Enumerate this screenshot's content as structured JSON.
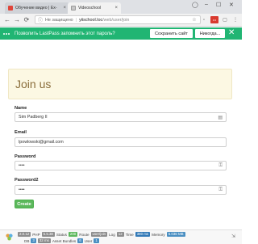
{
  "browser": {
    "tabs": [
      {
        "title": "Обучение видео | Ex-"
      },
      {
        "title": "Videoschool"
      }
    ],
    "window_controls": {
      "minimize": "–",
      "maximize": "☐",
      "close": "✕"
    },
    "url": {
      "security": "Не защищено",
      "host": "yiischool.loc",
      "path": "/web/user/join"
    }
  },
  "lastpass": {
    "message": "Позволить LastPass запомнить этот пароль?",
    "save_label": "Сохранить сайт",
    "never_label": "Никогда..."
  },
  "page": {
    "title": "Join us",
    "fields": [
      {
        "label": "Name",
        "value": "Sim Padberg II"
      },
      {
        "label": "Email",
        "value": "lpowlowski@gmail.com"
      },
      {
        "label": "Password",
        "value": "••••"
      },
      {
        "label": "Password2",
        "value": "••••"
      }
    ],
    "submit_label": "Create"
  },
  "debug": {
    "row1": [
      {
        "text": "2.0.12",
        "style": "gray"
      },
      {
        "text": "PHP",
        "style": "plain"
      },
      {
        "text": "5.5.38",
        "style": "gray"
      },
      {
        "text": "Status",
        "style": "plain"
      },
      {
        "text": "200",
        "style": "green"
      },
      {
        "text": "Route",
        "style": "plain"
      },
      {
        "text": "user/join",
        "style": "gray"
      },
      {
        "text": "Log",
        "style": "plain"
      },
      {
        "text": "12",
        "style": "gray"
      },
      {
        "text": "Time",
        "style": "plain"
      },
      {
        "text": "380 ms",
        "style": "blue"
      },
      {
        "text": "Memory",
        "style": "plain"
      },
      {
        "text": "6.036 MB",
        "style": "steel"
      }
    ],
    "row2": [
      {
        "text": "DB",
        "style": "plain"
      },
      {
        "text": "3",
        "style": "steel"
      },
      {
        "text": "32 ms",
        "style": "gray"
      },
      {
        "text": "Asset Bundles",
        "style": "plain"
      },
      {
        "text": "6",
        "style": "steel"
      },
      {
        "text": "User",
        "style": "plain"
      },
      {
        "text": "1",
        "style": "steel"
      }
    ]
  },
  "colors": {
    "lastpass_green": "#21b573",
    "jumbotron_bg": "#fcf8e3",
    "heading_brown": "#8a6d3b",
    "create_green": "#5cb85c"
  }
}
